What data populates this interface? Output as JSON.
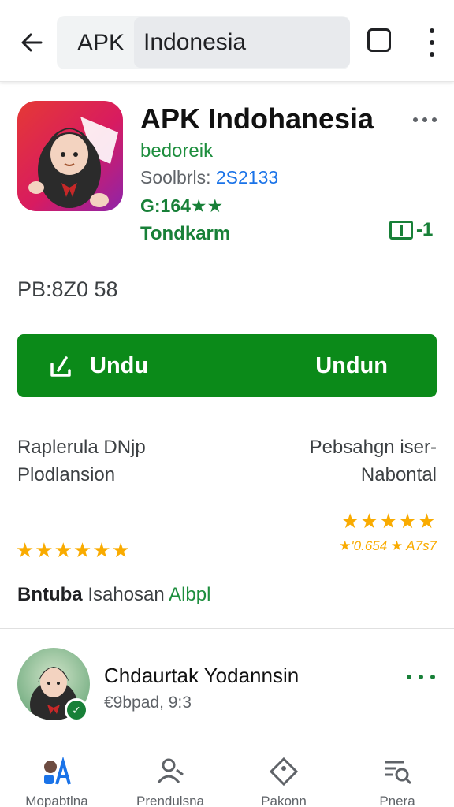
{
  "top_bar": {
    "search_prefix": "APK",
    "search_value": "Indonesia"
  },
  "app": {
    "title": "APK Indohanesia",
    "developer": "bedoreik",
    "size_label": "Soolbrls:",
    "size_value": "2S2133",
    "rating_text": "G:164★★",
    "category": "Tondkarm",
    "badge_text": "-1",
    "version": "PB:8Z0 58"
  },
  "download": {
    "left_label": "Undu",
    "right_label": "Undun"
  },
  "info": {
    "left_line1": "Raplerula DNjp",
    "left_line2": "Plodlansion",
    "right_line1": "Pebsahgn iser-",
    "right_line2": "Nabontal"
  },
  "ratings": {
    "stars_right": "★★★★★",
    "stars_left": "★★★★★★",
    "count_text": "★'0.654 ★ A7s7"
  },
  "section": {
    "bold": "Bntuba",
    "normal": "Isahosan",
    "green": "Albpl"
  },
  "review": {
    "name": "Chdaurtak Yodannsin",
    "meta": "€9bpad, 9:3"
  },
  "bottom_nav": {
    "items": [
      {
        "label": "Mopabtlna"
      },
      {
        "label": "Prendulsna"
      },
      {
        "label": "Pakonn"
      },
      {
        "label": "Pnera"
      }
    ]
  },
  "colors": {
    "accent_green": "#0b8a19",
    "text_green": "#188038",
    "link_blue": "#1a73e8",
    "star_yellow": "#f9ab00"
  }
}
